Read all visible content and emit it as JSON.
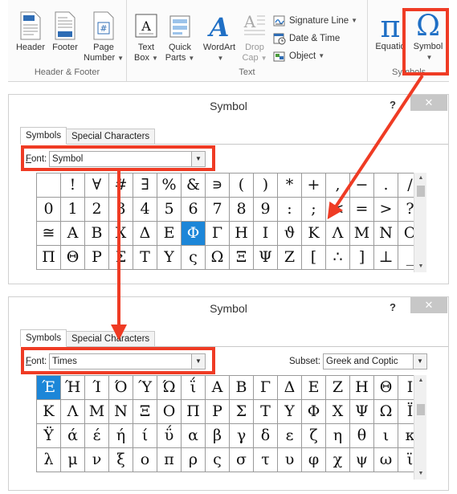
{
  "ribbon": {
    "groups": {
      "header_footer": {
        "label": "Header & Footer"
      },
      "text": {
        "label": "Text"
      },
      "symbols": {
        "label": "Symbols"
      }
    },
    "buttons": {
      "header": "Header",
      "footer": "Footer",
      "page_number_1": "Page",
      "page_number_2": "Number",
      "text_box_1": "Text",
      "text_box_2": "Box",
      "quick_parts_1": "Quick",
      "quick_parts_2": "Parts",
      "wordart": "WordArt",
      "drop_cap_1": "Drop",
      "drop_cap_2": "Cap",
      "signature_line": "Signature Line",
      "date_time": "Date & Time",
      "object": "Object",
      "equation": "Equatio",
      "symbol": "Symbol"
    },
    "glyphs": {
      "pi": "π",
      "omega": "Ω",
      "page_hash": "#",
      "wordart_a": "A",
      "dropcap_a": "A"
    }
  },
  "dialog1": {
    "title": "Symbol",
    "help": "?",
    "close": "✕",
    "tabs": [
      "Symbols",
      "Special Characters"
    ],
    "font_label_u": "F",
    "font_label_rest": "ont:",
    "font_value": "Symbol",
    "rows": [
      [
        "",
        "!",
        "∀",
        "#",
        "∃",
        "%",
        "&",
        "∍",
        "(",
        ")",
        "*",
        "+",
        ",",
        "−",
        ".",
        "/"
      ],
      [
        "0",
        "1",
        "2",
        "3",
        "4",
        "5",
        "6",
        "7",
        "8",
        "9",
        ":",
        ";",
        "<",
        "=",
        ">",
        "?"
      ],
      [
        "≅",
        "Α",
        "Β",
        "Χ",
        "Δ",
        "Ε",
        "Φ",
        "Γ",
        "Η",
        "Ι",
        "ϑ",
        "Κ",
        "Λ",
        "Μ",
        "Ν",
        "Ο"
      ],
      [
        "Π",
        "Θ",
        "Ρ",
        "Σ",
        "Τ",
        "Υ",
        "ς",
        "Ω",
        "Ξ",
        "Ψ",
        "Ζ",
        "[",
        "∴",
        "]",
        "⊥",
        "_"
      ]
    ],
    "selected": {
      "row": 2,
      "col": 6
    }
  },
  "dialog2": {
    "title": "Symbol",
    "help": "?",
    "close": "✕",
    "tabs": [
      "Symbols",
      "Special Characters"
    ],
    "font_label_u": "F",
    "font_label_rest": "ont:",
    "font_value": "Times",
    "subset_label": "Subset:",
    "subset_value": "Greek and Coptic",
    "rows": [
      [
        "Έ",
        "Ή",
        "Ί",
        "Ό",
        "Ύ",
        "Ώ",
        "ΐ",
        "Α",
        "Β",
        "Γ",
        "Δ",
        "Ε",
        "Ζ",
        "Η",
        "Θ",
        "Ι"
      ],
      [
        "Κ",
        "Λ",
        "Μ",
        "Ν",
        "Ξ",
        "Ο",
        "Π",
        "Ρ",
        "Σ",
        "Τ",
        "Υ",
        "Φ",
        "Χ",
        "Ψ",
        "Ω",
        "Ϊ"
      ],
      [
        "Ϋ",
        "ά",
        "έ",
        "ή",
        "ί",
        "ΰ",
        "α",
        "β",
        "γ",
        "δ",
        "ε",
        "ζ",
        "η",
        "θ",
        "ι",
        "κ"
      ],
      [
        "λ",
        "μ",
        "ν",
        "ξ",
        "ο",
        "π",
        "ρ",
        "ς",
        "σ",
        "τ",
        "υ",
        "φ",
        "χ",
        "ψ",
        "ω",
        "ϊ"
      ]
    ],
    "selected": {
      "row": 0,
      "col": 0
    }
  },
  "colors": {
    "highlight": "#ef3b24",
    "accent": "#1f6fc5",
    "selection": "#1c86d8"
  },
  "icons": [
    "header-icon",
    "footer-icon",
    "page-number-icon",
    "text-box-icon",
    "quick-parts-icon",
    "wordart-icon",
    "drop-cap-icon",
    "signature-line-icon",
    "date-time-icon",
    "object-icon",
    "equation-icon",
    "symbol-icon"
  ]
}
